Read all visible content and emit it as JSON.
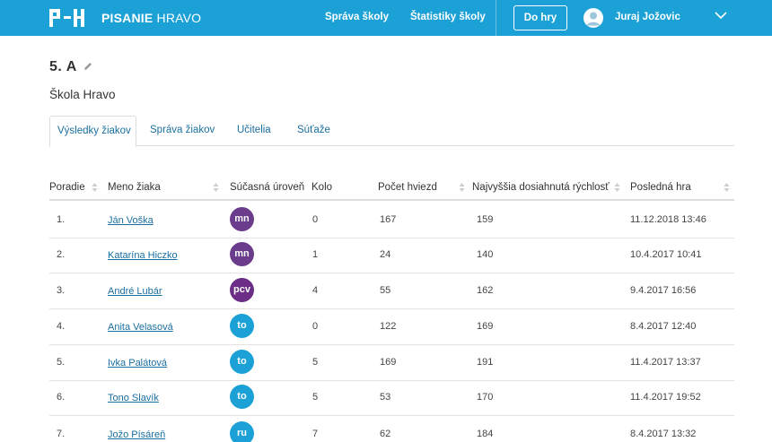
{
  "header": {
    "brand_bold": "PISANIE",
    "brand_light": " HRAVO",
    "nav": [
      "Správa školy",
      "Štatistiky školy"
    ],
    "play_label": "Do hry",
    "user_name": "Juraj Jožovic"
  },
  "class": {
    "title": "5. A",
    "school": "Škola Hravo"
  },
  "tabs": [
    {
      "label": "Výsledky žiakov",
      "active": true
    },
    {
      "label": "Správa žiakov",
      "active": false
    },
    {
      "label": "Učitelia",
      "active": false
    },
    {
      "label": "Súťaže",
      "active": false
    }
  ],
  "table": {
    "columns": [
      "Poradie",
      "Meno žiaka",
      "Súčasná úroveň",
      "Kolo",
      "Počet hviezd",
      "Najvyššia dosiahnutá rýchlosť",
      "Posledná hra"
    ],
    "rows": [
      {
        "rank": "1.",
        "name": "Ján Voška",
        "level": "mn",
        "round": "0",
        "stars": "167",
        "speed": "159",
        "last": "11.12.2018 13:46"
      },
      {
        "rank": "2.",
        "name": "Katarína Hiczko",
        "level": "mn",
        "round": "1",
        "stars": "24",
        "speed": "140",
        "last": "10.4.2017 10:41"
      },
      {
        "rank": "3.",
        "name": "André Lubár",
        "level": "pcv",
        "round": "4",
        "stars": "55",
        "speed": "162",
        "last": "9.4.2017 16:56"
      },
      {
        "rank": "4.",
        "name": "Anita Velasová",
        "level": "to",
        "round": "0",
        "stars": "122",
        "speed": "169",
        "last": "8.4.2017 12:40"
      },
      {
        "rank": "5.",
        "name": "Ivka Palátová",
        "level": "to",
        "round": "5",
        "stars": "169",
        "speed": "191",
        "last": "11.4.2017 13:37"
      },
      {
        "rank": "6.",
        "name": "Tono Slavík",
        "level": "to",
        "round": "5",
        "stars": "53",
        "speed": "170",
        "last": "11.4.2017 19:52"
      },
      {
        "rank": "7.",
        "name": "Jožo Písáreň",
        "level": "ru",
        "round": "7",
        "stars": "62",
        "speed": "184",
        "last": "8.4.2017 13:32"
      }
    ]
  },
  "colors": {
    "header_bg": "#1ba1d6",
    "level_mn": "#6b3b8c",
    "level_pcv": "#6b2d86",
    "level_to": "#1ba1d6",
    "level_ru": "#1ba1d6",
    "link": "#1a6fa0"
  },
  "icons": [
    "logo-mark",
    "edit-pencil-icon",
    "user-avatar-icon",
    "chevron-down-icon",
    "sort-icon"
  ]
}
